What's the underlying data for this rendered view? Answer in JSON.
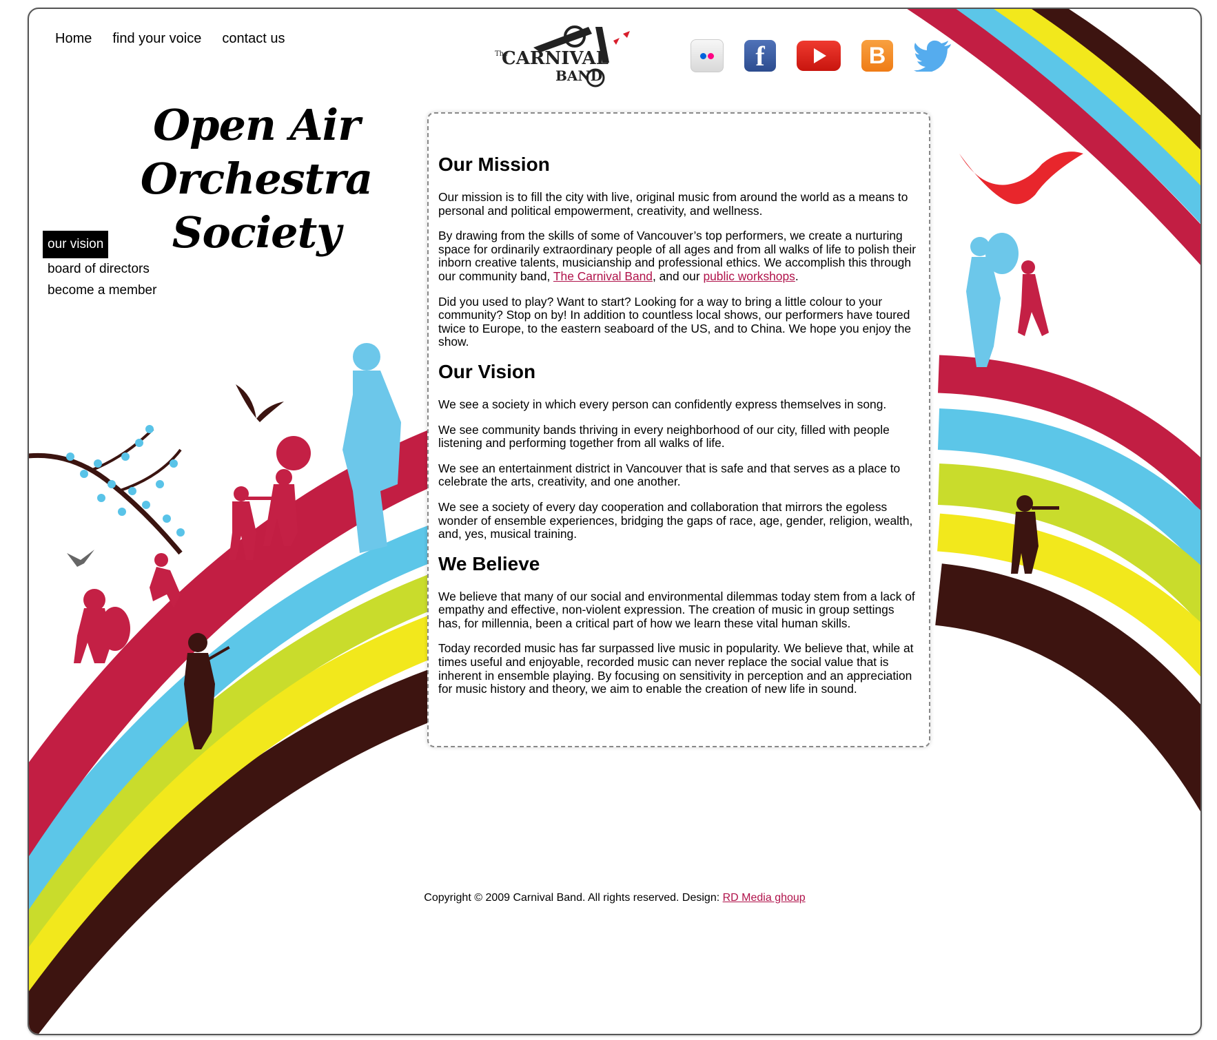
{
  "nav": {
    "home": "Home",
    "find_your_voice": "find your voice",
    "contact_us": "contact us"
  },
  "logo": {
    "the": "The",
    "name": "CARNIVAL",
    "band": "BAND"
  },
  "socials": {
    "facebook": "f",
    "blogger": "B"
  },
  "site_title": {
    "line1": "Open Air",
    "line2": "Orchestra Society"
  },
  "sidebar": {
    "items": [
      {
        "label": "our vision",
        "active": true
      },
      {
        "label": "board of directors",
        "active": false
      },
      {
        "label": "become a member",
        "active": false
      }
    ]
  },
  "mission": {
    "heading": "Our Mission",
    "p1": "Our mission is to fill the city with live, original music from around the world as a means to personal and political empowerment, creativity, and wellness.",
    "p2_before": "By drawing from the skills of some of Vancouver’s top performers, we create a nurturing space for ordinarily extraordinary people of all ages and from all walks of life to polish their inborn creative talents, musicianship and professional ethics. We accomplish this through our community band, ",
    "p2_link1": "The Carnival Band",
    "p2_middle": ", and our ",
    "p2_link2": "public workshops",
    "p2_after": ".",
    "p3": "Did you used to play? Want to start? Looking for a way to bring a little colour to your community? Stop on by! In addition to countless local shows, our performers have toured twice to Europe, to the eastern seaboard of the US, and to China. We hope you enjoy the show."
  },
  "vision": {
    "heading": "Our Vision",
    "p1": "We see a society in which every person can confidently express themselves in song.",
    "p2": "We see community bands thriving in every neighborhood of our city, filled with people listening and performing together from all walks of life.",
    "p3": "We see an entertainment district in Vancouver that is safe and that serves as a place to celebrate the arts, creativity, and one another.",
    "p4": "We see a society of every day cooperation and collaboration that mirrors the egoless wonder of ensemble experiences, bridging the gaps of race, age, gender, religion, wealth, and, yes, musical training."
  },
  "believe": {
    "heading": "We Believe",
    "p1": "We believe that many of our social and environmental dilemmas today stem from a lack of empathy and effective, non-violent expression. The creation of music in group settings has, for millennia, been a critical part of how we learn these vital human skills.",
    "p2": "Today recorded music has far surpassed live music in popularity. We believe that, while at times useful and enjoyable, recorded music can never replace the social value that is inherent in ensemble playing. By focusing on sensitivity in perception and an appreciation for music history and theory, we aim to enable the creation of new life in sound."
  },
  "footer": {
    "text": "Copyright © 2009 Carnival Band. All rights reserved. Design: ",
    "link": "RD Media ghoup"
  },
  "colors": {
    "stripe_red": "#c21e43",
    "stripe_blue": "#5cc6e8",
    "stripe_green": "#c9dc2c",
    "stripe_yellow": "#f2e81c",
    "stripe_brown": "#3d1410",
    "silhouette_blue": "#6cc7ea",
    "silhouette_red": "#c42045",
    "silhouette_dark": "#3b1410",
    "bird_red": "#e8262c",
    "link": "#b0124a"
  }
}
